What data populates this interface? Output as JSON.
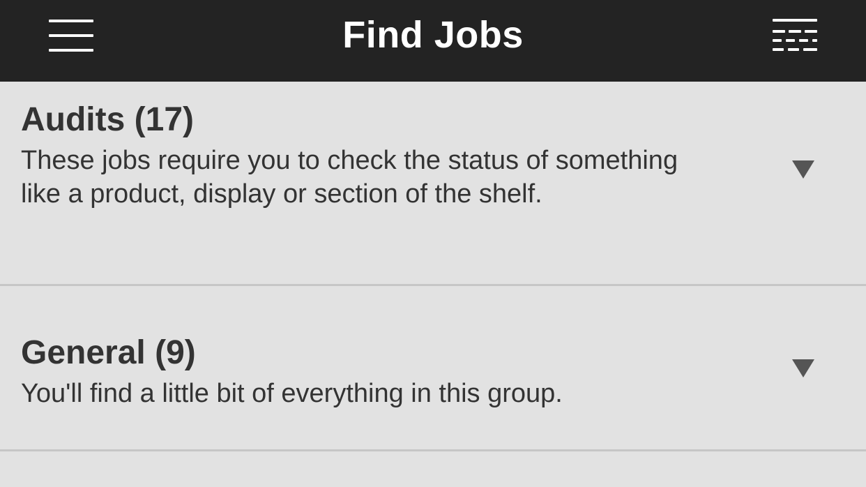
{
  "header": {
    "title": "Find Jobs",
    "left_icon": "menu-icon",
    "right_icon": "filter-icon"
  },
  "groups": [
    {
      "title": "Audits (17)",
      "description": "These jobs require you to check the status of something like a product, display or section of the shelf.",
      "icon": "chevron-down-icon"
    },
    {
      "title": "General (9)",
      "description": "You'll find a little bit of everything in this group.",
      "icon": "chevron-down-icon"
    }
  ],
  "colors": {
    "navbar": "#232323",
    "background": "#e2e2e2",
    "text": "#333333",
    "divider": "#c6c6c6",
    "chevron": "#555555"
  }
}
